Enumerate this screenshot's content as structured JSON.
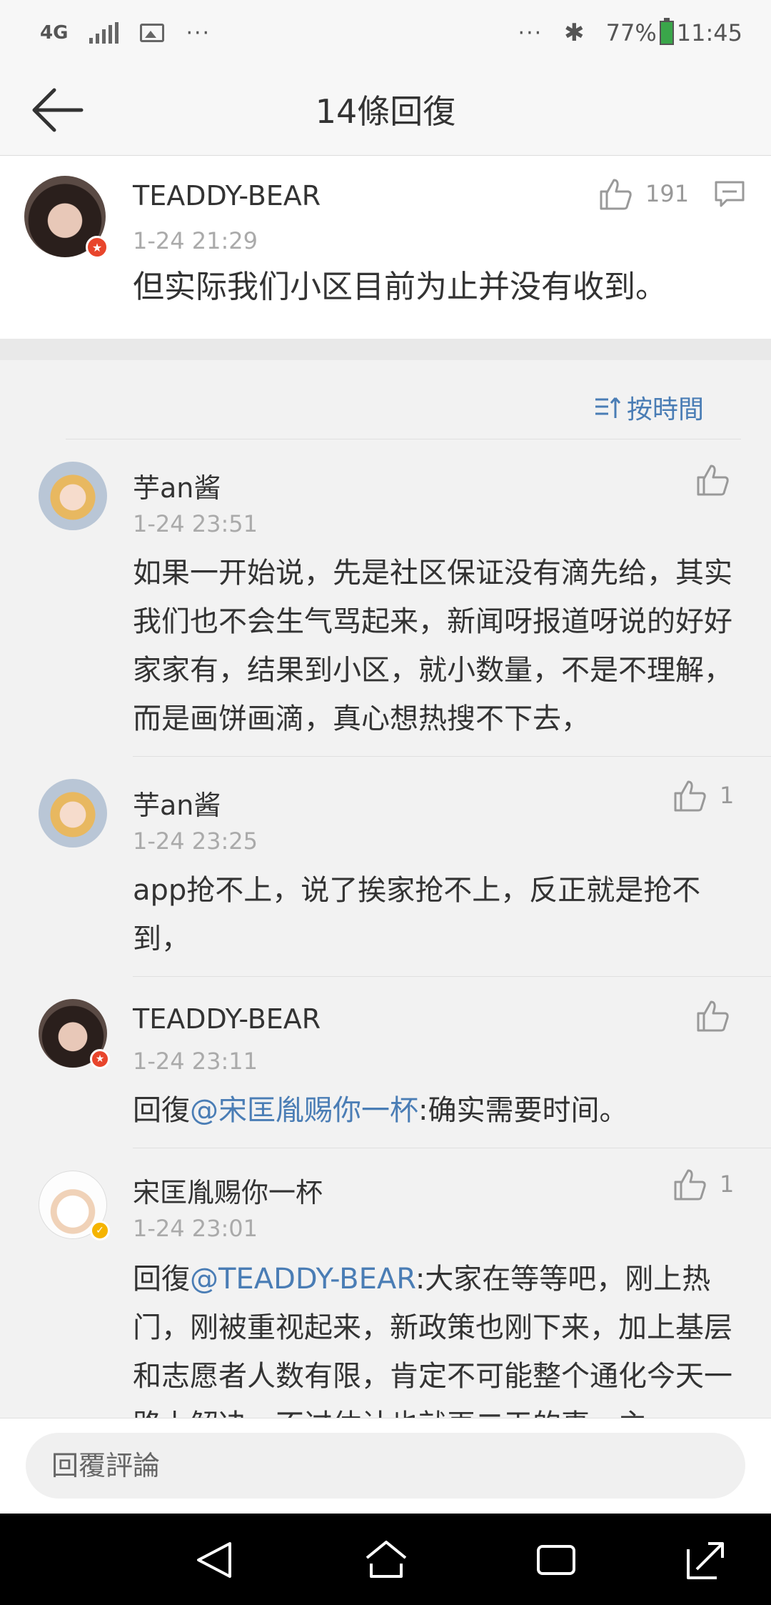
{
  "status_bar": {
    "network": "4G",
    "more": "···",
    "more_right": "···",
    "battery": "77%",
    "time": "11:45"
  },
  "nav": {
    "title": "14條回復"
  },
  "root_comment": {
    "username": "TEADDY-BEAR",
    "time": "1-24 21:29",
    "like_count": "191",
    "text": "但实际我们小区目前为止并没有收到。"
  },
  "sort": {
    "label": "按時間"
  },
  "replies": [
    {
      "username": "芋an酱",
      "time": "1-24 23:51",
      "like_count": "",
      "text": "如果一开始说，先是社区保证没有滴先给，其实我们也不会生气骂起来，新闻呀报道呀说的好好家家有，结果到小区，就小数量，不是不理解，而是画饼画滴，真心想热搜不下去，"
    },
    {
      "username": "芋an酱",
      "time": "1-24 23:25",
      "like_count": "1",
      "text": "app抢不上，说了挨家抢不上，反正就是抢不到，"
    },
    {
      "username": "TEADDY-BEAR",
      "time": "1-24 23:11",
      "like_count": "",
      "prefix": "回復",
      "mention": "@宋匡胤赐你一杯",
      "text": ":确实需要时间。"
    },
    {
      "username": "宋匡胤赐你一杯",
      "time": "1-24 23:01",
      "like_count": "1",
      "prefix": "回復",
      "mention": "@TEADDY-BEAR",
      "text": ":大家在等等吧，刚上热门，刚被重视起来，新政策也刚下来，加上基层和志愿者人数有限，肯定不可能整个通化今天一路上解决，不过估计也就再二天的事，主"
    }
  ],
  "input": {
    "placeholder": "回覆評論"
  },
  "colors": {
    "accent": "#4a7db5",
    "badge_red": "#e8452c",
    "badge_gold": "#f5b400"
  }
}
